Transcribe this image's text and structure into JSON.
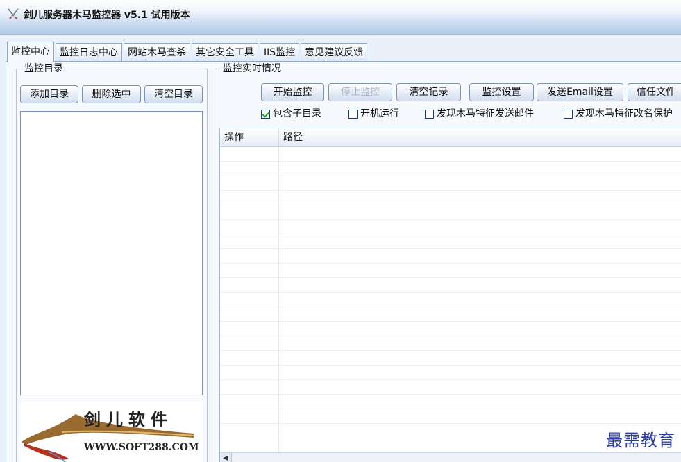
{
  "window": {
    "title": "剑儿服务器木马监控器 v5.1  试用版本"
  },
  "tabs": [
    {
      "label": "监控中心",
      "active": true
    },
    {
      "label": "监控日志中心"
    },
    {
      "label": "网站木马查杀"
    },
    {
      "label": "其它安全工具"
    },
    {
      "label": "IIS监控"
    },
    {
      "label": "意见建议反馈"
    }
  ],
  "directory_panel": {
    "legend": "监控目录",
    "buttons": {
      "add": "添加目录",
      "delete_selected": "删除选中",
      "clear": "清空目录"
    },
    "logo": {
      "title": "剑儿软件",
      "url": "WWW.SOFT288.COM"
    }
  },
  "realtime_panel": {
    "legend": "监控实时情况",
    "buttons": {
      "start": "开始监控",
      "stop": "停止监控",
      "clear_records": "清空记录",
      "settings": "监控设置",
      "email_settings": "发送Email设置",
      "trusted_files": "信任文件"
    },
    "options": {
      "include_subdirs": {
        "label": "包含子目录",
        "checked": true
      },
      "run_at_startup": {
        "label": "开机运行",
        "checked": false
      },
      "send_email_on_detect": {
        "label": "发现木马特征发送邮件",
        "checked": false
      },
      "rename_protect": {
        "label": "发现木马特征改名保护",
        "checked": false
      }
    },
    "table": {
      "columns": [
        "操作",
        "路径"
      ]
    }
  },
  "watermark": "最需教育",
  "colors": {
    "accent_check": "#21a121",
    "watermark": "#2d3ea8"
  }
}
